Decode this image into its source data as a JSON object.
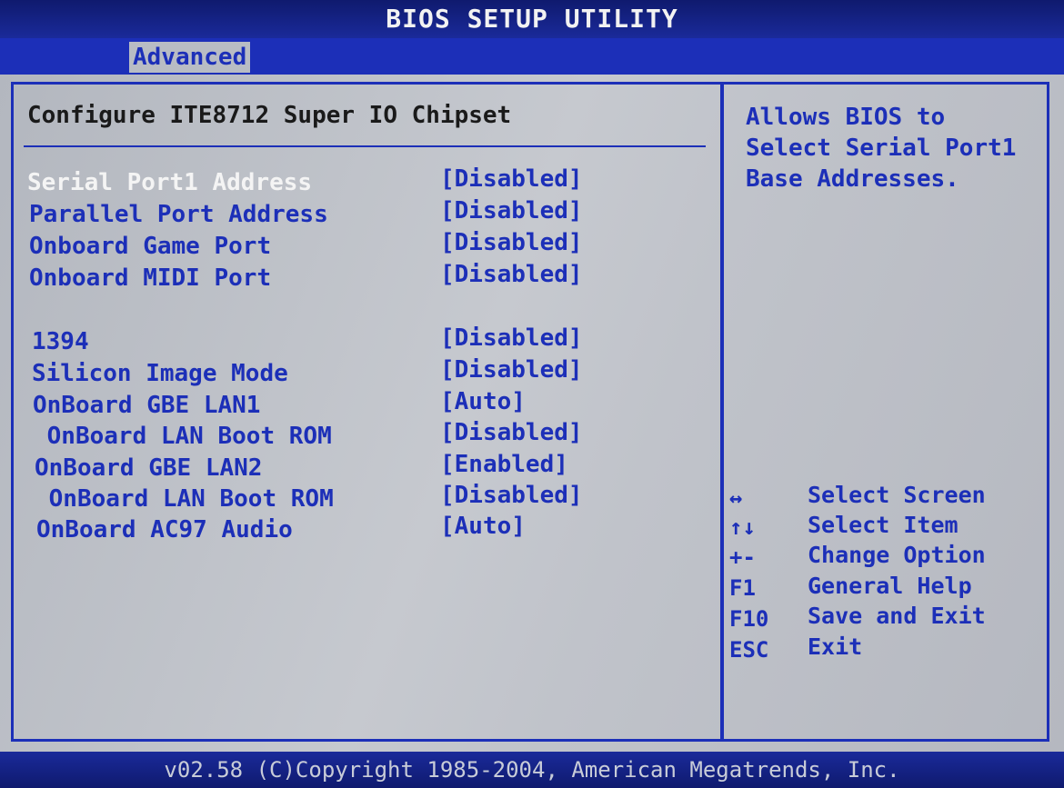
{
  "title": "BIOS SETUP UTILITY",
  "tabs": [
    {
      "label": "Advanced"
    }
  ],
  "section_title": "Configure ITE8712 Super IO Chipset",
  "settings": [
    {
      "label": "Serial Port1 Address",
      "value": "[Disabled]",
      "selected": true
    },
    {
      "label": "Parallel Port Address",
      "value": "[Disabled]"
    },
    {
      "label": "Onboard Game Port",
      "value": "[Disabled]"
    },
    {
      "label": "Onboard MIDI Port",
      "value": "[Disabled]"
    },
    {
      "label": "1394",
      "value": "[Disabled]"
    },
    {
      "label": "Silicon Image Mode",
      "value": "[Disabled]"
    },
    {
      "label": "OnBoard GBE LAN1",
      "value": "[Auto]"
    },
    {
      "label": " OnBoard LAN Boot ROM",
      "value": "[Disabled]"
    },
    {
      "label": "OnBoard GBE LAN2",
      "value": "[Enabled]"
    },
    {
      "label": " OnBoard LAN Boot ROM",
      "value": "[Disabled]"
    },
    {
      "label": "OnBoard AC97 Audio",
      "value": "[Auto]"
    }
  ],
  "help_text": "Allows BIOS to Select Serial Port1 Base Addresses.",
  "key_legend": [
    {
      "key": "↔",
      "desc": "Select Screen"
    },
    {
      "key": "↑↓",
      "desc": "Select Item"
    },
    {
      "key": "+-",
      "desc": "Change Option"
    },
    {
      "key": "F1",
      "desc": "General Help"
    },
    {
      "key": "F10",
      "desc": "Save and Exit"
    },
    {
      "key": "ESC",
      "desc": "Exit"
    }
  ],
  "footer": "v02.58 (C)Copyright 1985-2004, American Megatrends, Inc.",
  "colors": {
    "accent": "#1c2fb8",
    "background": "#b8bcc4",
    "selected_text": "#f4f4f4"
  }
}
